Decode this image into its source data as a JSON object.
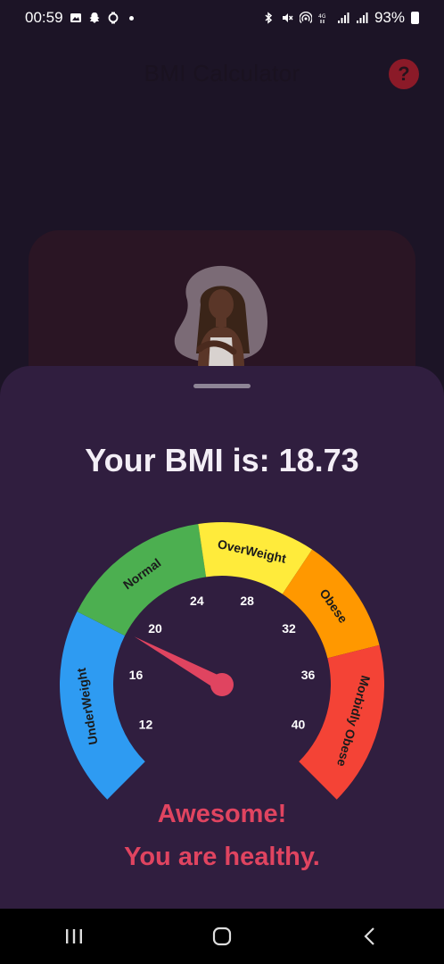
{
  "status_bar": {
    "time": "00:59",
    "battery": "93%"
  },
  "app_bar": {
    "title": "BMI Calculator",
    "help_icon": "question-icon"
  },
  "result_sheet": {
    "bmi_text": "Your BMI is: 18.73",
    "message_line1": "Awesome!",
    "message_line2": "You are healthy."
  },
  "chart_data": {
    "type": "gauge",
    "value": 18.73,
    "range": [
      10,
      42
    ],
    "segments": [
      {
        "label": "UnderWeight",
        "from": 10,
        "to": 18.5,
        "color": "#2e9bf2"
      },
      {
        "label": "Normal",
        "from": 18.5,
        "to": 25,
        "color": "#4caf50"
      },
      {
        "label": "OverWeight",
        "from": 25,
        "to": 30,
        "color": "#ffeb3b"
      },
      {
        "label": "Obese",
        "from": 30,
        "to": 35,
        "color": "#ff9800"
      },
      {
        "label": "Morbidly Obese",
        "from": 35,
        "to": 42,
        "color": "#f44336"
      }
    ],
    "ticks": [
      12,
      16,
      20,
      24,
      28,
      32,
      36,
      40
    ],
    "needle_color": "#e04460"
  },
  "nav_bar": {
    "items": [
      "recent-apps-icon",
      "home-icon",
      "back-icon"
    ]
  }
}
